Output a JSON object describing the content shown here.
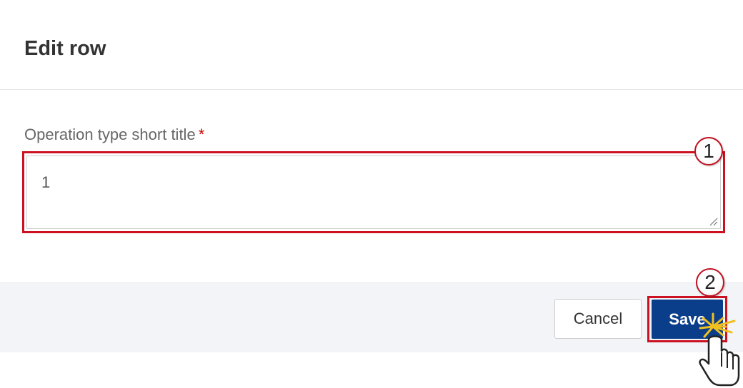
{
  "dialog": {
    "title": "Edit row"
  },
  "form": {
    "field_label": "Operation type short title",
    "required_marker": "*",
    "field_value": "1"
  },
  "footer": {
    "cancel_label": "Cancel",
    "save_label": "Save"
  },
  "callouts": {
    "first": "1",
    "second": "2"
  },
  "colors": {
    "highlight": "#cc1122",
    "primary_button": "#0a3e8a",
    "footer_bg": "#f3f4f7"
  },
  "icons": {
    "resize_handle": "resize-handle-icon",
    "cursor": "hand-pointer-icon"
  }
}
